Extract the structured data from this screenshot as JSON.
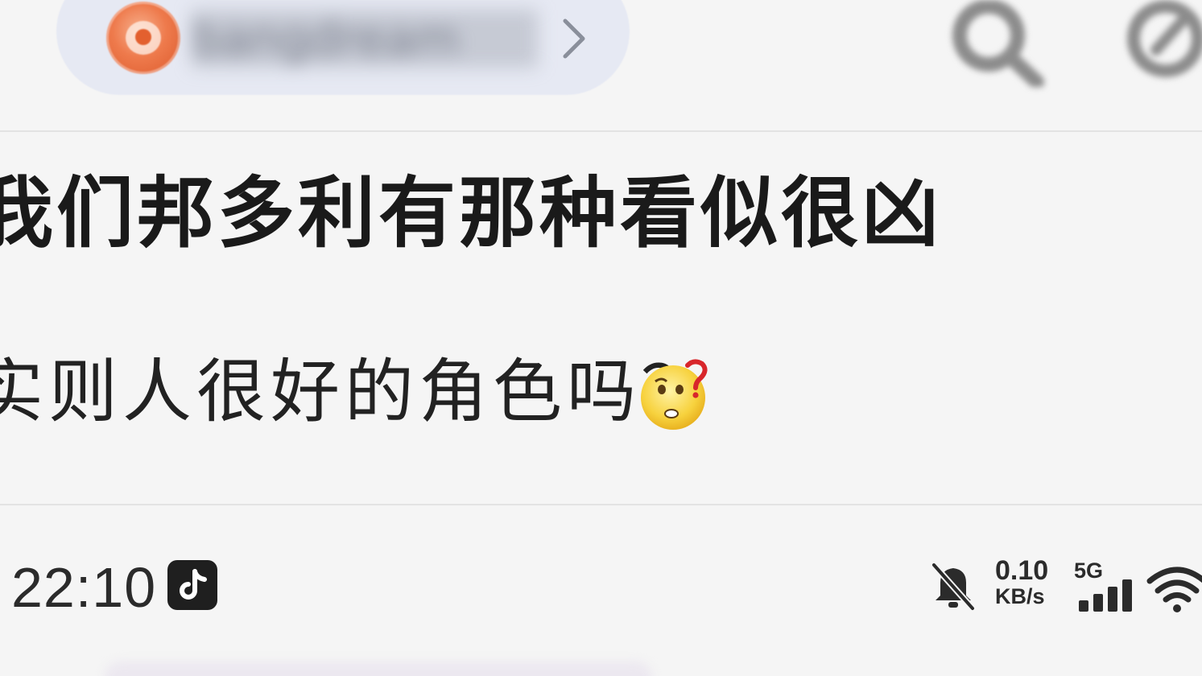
{
  "header": {
    "username": "bangdream",
    "username_blurred": true,
    "icons": [
      "avatar",
      "chevron-right-icon",
      "search-icon",
      "edit-icon"
    ],
    "pill_color": "#e6e9f3",
    "avatar_color": "#ee7a4c"
  },
  "post": {
    "line1": "我们邦多利有那种看似很凶",
    "line2": "实则人很好的角色吗？",
    "emoji": "thinking-question-emoji"
  },
  "statusbar": {
    "time": "22:10",
    "app_icon": "tiktok-icon",
    "notifications": "bell-off-icon",
    "net_speed_value": "0.10",
    "net_speed_unit": "KB/s",
    "network_type": "5G",
    "signal": "signal-icon",
    "wifi": "wifi-icon"
  }
}
